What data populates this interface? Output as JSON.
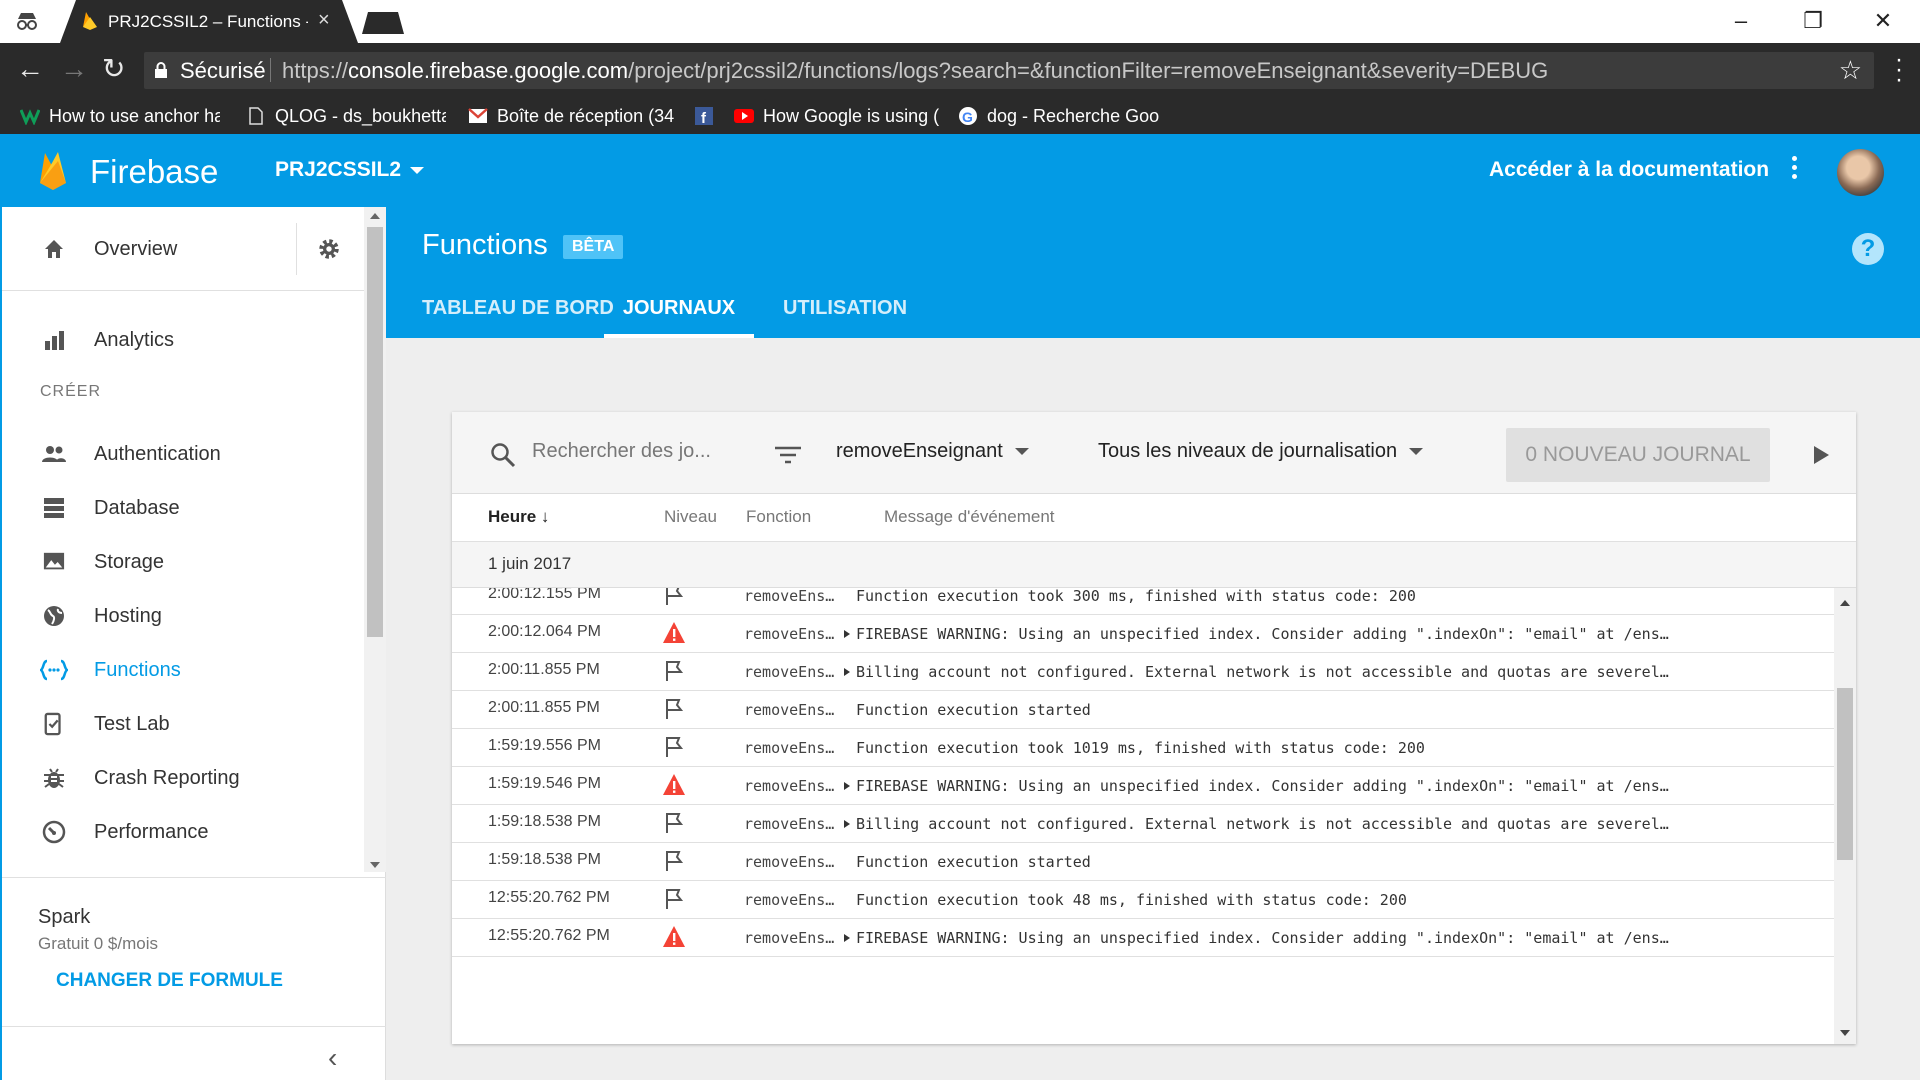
{
  "browser": {
    "tab_title": "PRJ2CSSIL2 – Functions -",
    "tab_close": "×",
    "secure_label": "Sécurisé",
    "url_scheme": "https://",
    "url_host": "console.firebase.google.com",
    "url_path": "/project/prj2cssil2/functions/logs?search=&functionFilter=removeEnseignant&severity=DEBUG",
    "bookmarks": [
      {
        "label": "How to use anchor ha",
        "icon": "medium-icon"
      },
      {
        "label": "QLOG - ds_boukhetta",
        "icon": "document-icon"
      },
      {
        "label": "Boîte de réception (34",
        "icon": "gmail-icon"
      },
      {
        "label": "",
        "icon": "facebook-icon"
      },
      {
        "label": "How Google is using (",
        "icon": "youtube-icon"
      },
      {
        "label": "dog - Recherche Goo",
        "icon": "google-icon"
      }
    ]
  },
  "header": {
    "brand": "Firebase",
    "project": "PRJ2CSSIL2",
    "docs_link": "Accéder à la documentation"
  },
  "sidebar": {
    "overview": "Overview",
    "analytics": "Analytics",
    "section_create": "CRÉER",
    "items": [
      {
        "label": "Authentication",
        "icon": "people-icon"
      },
      {
        "label": "Database",
        "icon": "database-icon"
      },
      {
        "label": "Storage",
        "icon": "image-icon"
      },
      {
        "label": "Hosting",
        "icon": "globe-icon"
      },
      {
        "label": "Functions",
        "icon": "functions-icon",
        "active": true
      },
      {
        "label": "Test Lab",
        "icon": "test-lab-icon"
      },
      {
        "label": "Crash Reporting",
        "icon": "bug-icon"
      },
      {
        "label": "Performance",
        "icon": "speedometer-icon"
      }
    ],
    "plan": {
      "name": "Spark",
      "price": "Gratuit 0 $/mois",
      "change": "CHANGER DE FORMULE"
    }
  },
  "page": {
    "title": "Functions",
    "badge": "BÊTA",
    "help": "?",
    "tabs": [
      {
        "label": "TABLEAU DE BORD"
      },
      {
        "label": "JOURNAUX",
        "active": true
      },
      {
        "label": "UTILISATION"
      }
    ]
  },
  "logs": {
    "search_placeholder": "Rechercher des jo...",
    "function_filter": "removeEnseignant",
    "level_filter": "Tous les niveaux de journalisation",
    "new_log_button": "0 NOUVEAU JOURNAL",
    "columns": {
      "time": "Heure",
      "level": "Niveau",
      "function": "Fonction",
      "message": "Message d'événement"
    },
    "date": "1 juin 2017",
    "rows": [
      {
        "time": "2:00:12.155 PM",
        "level": "flag-icon",
        "function": "removeEns…",
        "expandable": false,
        "message": "Function execution took 300 ms, finished with status code: 200"
      },
      {
        "time": "2:00:12.064 PM",
        "level": "warning-icon",
        "function": "removeEns…",
        "expandable": true,
        "message": "FIREBASE WARNING: Using an unspecified index. Consider adding \".indexOn\": \"email\" at /ens…"
      },
      {
        "time": "2:00:11.855 PM",
        "level": "flag-icon",
        "function": "removeEns…",
        "expandable": true,
        "message": "Billing account not configured. External network is not accessible and quotas are severel…"
      },
      {
        "time": "2:00:11.855 PM",
        "level": "flag-icon",
        "function": "removeEns…",
        "expandable": false,
        "message": "Function execution started"
      },
      {
        "time": "1:59:19.556 PM",
        "level": "flag-icon",
        "function": "removeEns…",
        "expandable": false,
        "message": "Function execution took 1019 ms, finished with status code: 200"
      },
      {
        "time": "1:59:19.546 PM",
        "level": "warning-icon",
        "function": "removeEns…",
        "expandable": true,
        "message": "FIREBASE WARNING: Using an unspecified index. Consider adding \".indexOn\": \"email\" at /ens…"
      },
      {
        "time": "1:59:18.538 PM",
        "level": "flag-icon",
        "function": "removeEns…",
        "expandable": true,
        "message": "Billing account not configured. External network is not accessible and quotas are severel…"
      },
      {
        "time": "1:59:18.538 PM",
        "level": "flag-icon",
        "function": "removeEns…",
        "expandable": false,
        "message": "Function execution started"
      },
      {
        "time": "12:55:20.762 PM",
        "level": "flag-icon",
        "function": "removeEns…",
        "expandable": false,
        "message": "Function execution took 48 ms, finished with status code: 200"
      },
      {
        "time": "12:55:20.762 PM",
        "level": "warning-icon",
        "function": "removeEns…",
        "expandable": true,
        "message": "FIREBASE WARNING: Using an unspecified index. Consider adding \".indexOn\": \"email\" at /ens…"
      }
    ]
  },
  "colors": {
    "firebase_blue": "#039be5",
    "warning_red": "#f44336",
    "chrome_dark": "#2a2a2a"
  }
}
